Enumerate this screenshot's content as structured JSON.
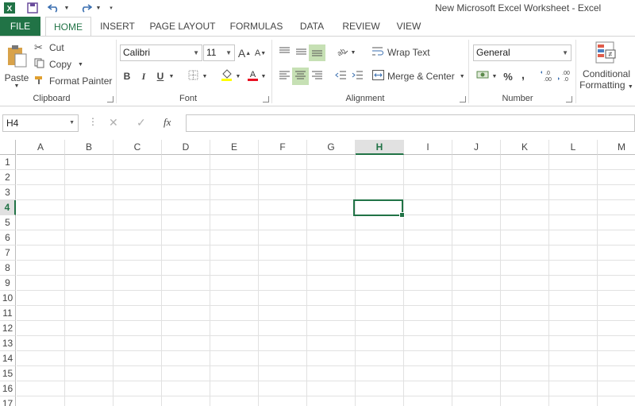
{
  "window": {
    "title": "New Microsoft Excel Worksheet - Excel"
  },
  "colors": {
    "accent": "#217346",
    "selected_bg": "#c6e0b4",
    "font_color_bar": "#e81123",
    "highlight_bar": "#ffff00"
  },
  "tabs": [
    {
      "label": "FILE"
    },
    {
      "label": "HOME"
    },
    {
      "label": "INSERT"
    },
    {
      "label": "PAGE LAYOUT"
    },
    {
      "label": "FORMULAS"
    },
    {
      "label": "DATA"
    },
    {
      "label": "REVIEW"
    },
    {
      "label": "VIEW"
    }
  ],
  "clipboard": {
    "label": "Clipboard",
    "paste": "Paste",
    "cut": "Cut",
    "copy": "Copy",
    "format_painter": "Format Painter"
  },
  "font": {
    "label": "Font",
    "name": "Calibri",
    "size": "11",
    "bold": "B",
    "italic": "I",
    "underline": "U",
    "grow": "A",
    "shrink": "A"
  },
  "alignment": {
    "label": "Alignment",
    "wrap_text": "Wrap Text",
    "merge_center": "Merge & Center"
  },
  "number": {
    "label": "Number",
    "format": "General",
    "percent": "%",
    "comma": ","
  },
  "styles": {
    "conditional": "Conditional",
    "formatting": "Formatting"
  },
  "formula_bar": {
    "name_box": "H4",
    "fx": "fx",
    "value": ""
  },
  "sheet": {
    "columns": [
      "A",
      "B",
      "C",
      "D",
      "E",
      "F",
      "G",
      "H",
      "I",
      "J",
      "K",
      "L",
      "M"
    ],
    "rows": [
      "1",
      "2",
      "3",
      "4",
      "5",
      "6",
      "7",
      "8",
      "9",
      "10",
      "11",
      "12",
      "13",
      "14",
      "15",
      "16",
      "17"
    ],
    "active_column": "H",
    "active_row": "4"
  }
}
